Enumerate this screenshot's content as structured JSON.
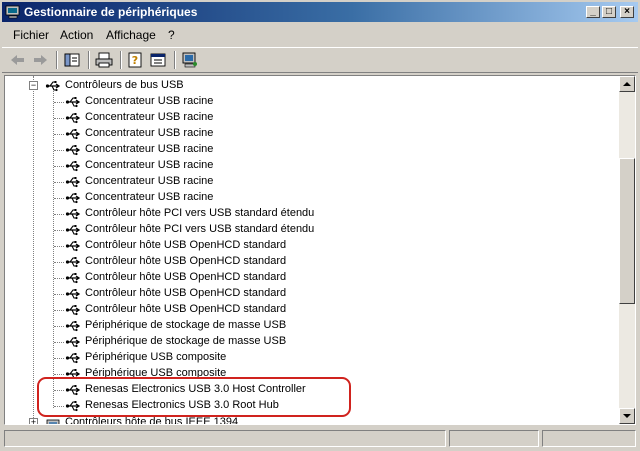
{
  "window": {
    "title": "Gestionnaire de périphériques"
  },
  "caption_buttons": {
    "minimize": "_",
    "maximize": "□",
    "close": "×"
  },
  "menu": {
    "items": [
      "Fichier",
      "Action",
      "Affichage",
      "?"
    ]
  },
  "toolbar": {
    "icons": [
      "back-arrow-icon",
      "forward-arrow-icon",
      "tree-view-icon",
      "print-icon",
      "help-properties-icon",
      "detail-view-icon",
      "scan-hardware-icon"
    ]
  },
  "tree": {
    "category": "Contrôleurs de bus USB",
    "items": [
      "Concentrateur USB racine",
      "Concentrateur USB racine",
      "Concentrateur USB racine",
      "Concentrateur USB racine",
      "Concentrateur USB racine",
      "Concentrateur USB racine",
      "Concentrateur USB racine",
      "Contrôleur hôte PCI vers USB standard étendu",
      "Contrôleur hôte PCI vers USB standard étendu",
      "Contrôleur hôte USB OpenHCD standard",
      "Contrôleur hôte USB OpenHCD standard",
      "Contrôleur hôte USB OpenHCD standard",
      "Contrôleur hôte USB OpenHCD standard",
      "Contrôleur hôte USB OpenHCD standard",
      "Périphérique de stockage de masse USB",
      "Périphérique de stockage de masse USB",
      "Périphérique USB composite",
      "Périphérique USB composite",
      "Renesas Electronics USB 3.0 Host Controller",
      "Renesas Electronics USB 3.0 Root Hub"
    ],
    "next_category": "Contrôleurs hôte de bus IEEE 1394"
  },
  "colors": {
    "titlebar_start": "#0a246a",
    "titlebar_end": "#a6caf0",
    "highlight": "#d0231e",
    "chrome": "#d4d0c8"
  }
}
